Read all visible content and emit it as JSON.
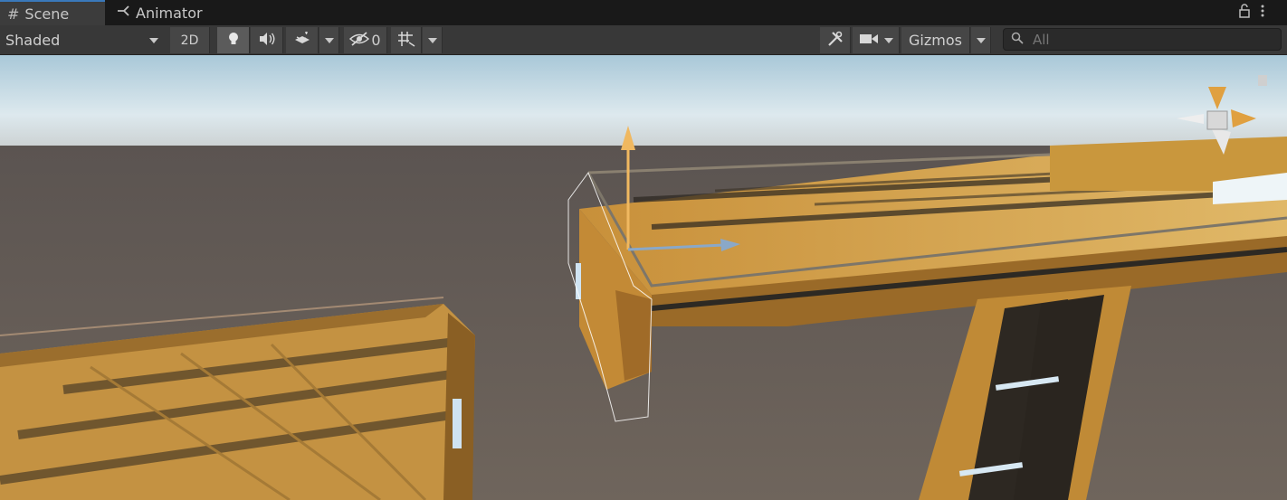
{
  "tabs": [
    {
      "label": "Scene",
      "icon": "grid-icon",
      "active": true
    },
    {
      "label": "Animator",
      "icon": "animator-icon",
      "active": false
    }
  ],
  "toolbar": {
    "draw_mode": "Shaded",
    "mode_2d": "2D",
    "hidden_count": "0",
    "gizmos_label": "Gizmos",
    "search_placeholder": "All"
  },
  "colors": {
    "tab_accent": "#3a79bb",
    "selection_outline": "#ffffff",
    "gizmo_arrow": "#f0b860",
    "sky": "#c5dde8",
    "ground": "#6b6259",
    "platform": "#c89a45"
  }
}
